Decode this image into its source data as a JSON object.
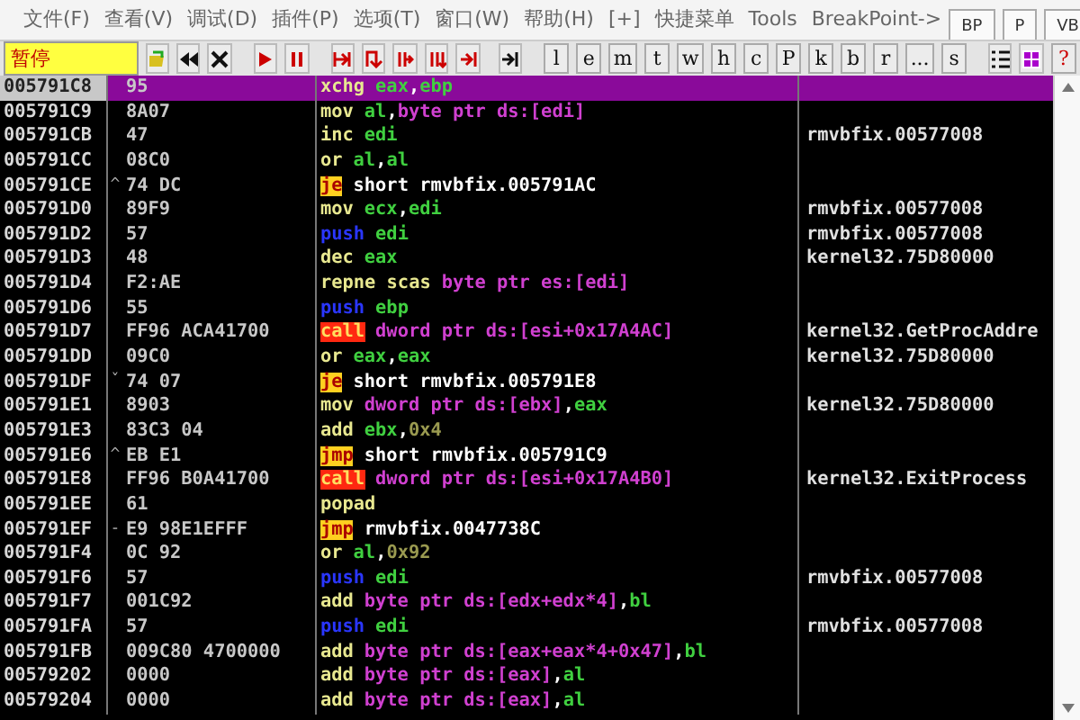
{
  "menu": [
    "文件(F)",
    "查看(V)",
    "调试(D)",
    "插件(P)",
    "选项(T)",
    "窗口(W)",
    "帮助(H)",
    "[+]",
    "快捷菜单",
    "Tools",
    "BreakPoint->"
  ],
  "window_tabs": [
    {
      "label": "BP",
      "selected": false
    },
    {
      "label": "P",
      "selected": false
    },
    {
      "label": "VB",
      "selected": false
    }
  ],
  "toolbar": {
    "status": "暂停",
    "letter_buttons": [
      "l",
      "e",
      "m",
      "t",
      "w",
      "h",
      "c",
      "P",
      "k",
      "b",
      "r",
      "...",
      "s"
    ],
    "help_button": "?"
  },
  "rows": [
    {
      "address": "005791C8",
      "hex": "95",
      "mnemonic": {
        "text": "xchg",
        "kind": "plain"
      },
      "operands": [
        {
          "text": "eax",
          "kind": "reg"
        },
        {
          "text": ",",
          "kind": "sep"
        },
        {
          "text": "ebp",
          "kind": "reg"
        }
      ],
      "selected": true
    },
    {
      "address": "005791C9",
      "hex": "8A07",
      "mnemonic": {
        "text": "mov",
        "kind": "plain"
      },
      "operands": [
        {
          "text": "al",
          "kind": "reg"
        },
        {
          "text": ",",
          "kind": "sep"
        },
        {
          "text": "byte ptr ds:[edi]",
          "kind": "mem"
        }
      ],
      "selected": false
    },
    {
      "address": "005791CB",
      "hex": "47",
      "mnemonic": {
        "text": "inc",
        "kind": "plain"
      },
      "operands": [
        {
          "text": "edi",
          "kind": "reg"
        }
      ],
      "comment": "rmvbfix.00577008",
      "selected": false
    },
    {
      "address": "005791CC",
      "hex": "08C0",
      "mnemonic": {
        "text": "or",
        "kind": "plain"
      },
      "operands": [
        {
          "text": "al",
          "kind": "reg"
        },
        {
          "text": ",",
          "kind": "sep"
        },
        {
          "text": "al",
          "kind": "reg"
        }
      ],
      "selected": false
    },
    {
      "address": "005791CE",
      "jump_mark": "^",
      "hex": "74 DC",
      "mnemonic": {
        "text": "je",
        "kind": "jcc"
      },
      "operands": [
        {
          "text": "short rmvbfix.005791AC",
          "kind": "label"
        }
      ],
      "selected": false
    },
    {
      "address": "005791D0",
      "hex": "89F9",
      "mnemonic": {
        "text": "mov",
        "kind": "plain"
      },
      "operands": [
        {
          "text": "ecx",
          "kind": "reg"
        },
        {
          "text": ",",
          "kind": "sep"
        },
        {
          "text": "edi",
          "kind": "reg"
        }
      ],
      "comment": "rmvbfix.00577008",
      "selected": false
    },
    {
      "address": "005791D2",
      "hex": "57",
      "mnemonic": {
        "text": "push",
        "kind": "push"
      },
      "operands": [
        {
          "text": "edi",
          "kind": "reg"
        }
      ],
      "comment": "rmvbfix.00577008",
      "selected": false
    },
    {
      "address": "005791D3",
      "hex": "48",
      "mnemonic": {
        "text": "dec",
        "kind": "plain"
      },
      "operands": [
        {
          "text": "eax",
          "kind": "reg"
        }
      ],
      "comment": "kernel32.75D80000",
      "selected": false
    },
    {
      "address": "005791D4",
      "hex": "F2:AE",
      "mnemonic": {
        "text": "repne scas",
        "kind": "plain"
      },
      "operands": [
        {
          "text": "byte ptr es:[edi]",
          "kind": "mem"
        }
      ],
      "selected": false
    },
    {
      "address": "005791D6",
      "hex": "55",
      "mnemonic": {
        "text": "push",
        "kind": "push"
      },
      "operands": [
        {
          "text": "ebp",
          "kind": "reg"
        }
      ],
      "selected": false
    },
    {
      "address": "005791D7",
      "hex": "FF96 ACA41700",
      "mnemonic": {
        "text": "call",
        "kind": "call"
      },
      "operands": [
        {
          "text": "dword ptr ds:[esi+0x17A4AC]",
          "kind": "mem"
        }
      ],
      "comment": "kernel32.GetProcAddre",
      "selected": false
    },
    {
      "address": "005791DD",
      "hex": "09C0",
      "mnemonic": {
        "text": "or",
        "kind": "plain"
      },
      "operands": [
        {
          "text": "eax",
          "kind": "reg"
        },
        {
          "text": ",",
          "kind": "sep"
        },
        {
          "text": "eax",
          "kind": "reg"
        }
      ],
      "comment": "kernel32.75D80000",
      "selected": false
    },
    {
      "address": "005791DF",
      "jump_mark": "ˇ",
      "hex": "74 07",
      "mnemonic": {
        "text": "je",
        "kind": "jcc"
      },
      "operands": [
        {
          "text": "short rmvbfix.005791E8",
          "kind": "label"
        }
      ],
      "selected": false
    },
    {
      "address": "005791E1",
      "hex": "8903",
      "mnemonic": {
        "text": "mov",
        "kind": "plain"
      },
      "operands": [
        {
          "text": "dword ptr ds:[ebx]",
          "kind": "mem"
        },
        {
          "text": ",",
          "kind": "sep"
        },
        {
          "text": "eax",
          "kind": "reg"
        }
      ],
      "comment": "kernel32.75D80000",
      "selected": false
    },
    {
      "address": "005791E3",
      "hex": "83C3 04",
      "mnemonic": {
        "text": "add",
        "kind": "plain"
      },
      "operands": [
        {
          "text": "ebx",
          "kind": "reg"
        },
        {
          "text": ",",
          "kind": "sep"
        },
        {
          "text": "0x4",
          "kind": "num"
        }
      ],
      "selected": false
    },
    {
      "address": "005791E6",
      "jump_mark": "^",
      "hex": "EB E1",
      "mnemonic": {
        "text": "jmp",
        "kind": "jmp"
      },
      "operands": [
        {
          "text": "short rmvbfix.005791C9",
          "kind": "label"
        }
      ],
      "selected": false
    },
    {
      "address": "005791E8",
      "hex": "FF96 B0A41700",
      "mnemonic": {
        "text": "call",
        "kind": "call"
      },
      "operands": [
        {
          "text": "dword ptr ds:[esi+0x17A4B0]",
          "kind": "mem"
        }
      ],
      "comment": "kernel32.ExitProcess",
      "selected": false
    },
    {
      "address": "005791EE",
      "hex": "61",
      "mnemonic": {
        "text": "popad",
        "kind": "plain"
      },
      "operands": [],
      "selected": false
    },
    {
      "address": "005791EF",
      "jump_mark": "-",
      "hex": "E9 98E1EFFF",
      "mnemonic": {
        "text": "jmp",
        "kind": "jmp"
      },
      "operands": [
        {
          "text": "rmvbfix.0047738C",
          "kind": "label"
        }
      ],
      "selected": false
    },
    {
      "address": "005791F4",
      "hex": "0C 92",
      "mnemonic": {
        "text": "or",
        "kind": "plain"
      },
      "operands": [
        {
          "text": "al",
          "kind": "reg"
        },
        {
          "text": ",",
          "kind": "sep"
        },
        {
          "text": "0x92",
          "kind": "num"
        }
      ],
      "selected": false
    },
    {
      "address": "005791F6",
      "hex": "57",
      "mnemonic": {
        "text": "push",
        "kind": "push"
      },
      "operands": [
        {
          "text": "edi",
          "kind": "reg"
        }
      ],
      "comment": "rmvbfix.00577008",
      "selected": false
    },
    {
      "address": "005791F7",
      "hex": "001C92",
      "mnemonic": {
        "text": "add",
        "kind": "plain"
      },
      "operands": [
        {
          "text": "byte ptr ds:[edx+edx*4]",
          "kind": "mem"
        },
        {
          "text": ",",
          "kind": "sep"
        },
        {
          "text": "bl",
          "kind": "reg"
        }
      ],
      "selected": false
    },
    {
      "address": "005791FA",
      "hex": "57",
      "mnemonic": {
        "text": "push",
        "kind": "push"
      },
      "operands": [
        {
          "text": "edi",
          "kind": "reg"
        }
      ],
      "comment": "rmvbfix.00577008",
      "selected": false
    },
    {
      "address": "005791FB",
      "hex": "009C80 4700000",
      "mnemonic": {
        "text": "add",
        "kind": "plain"
      },
      "operands": [
        {
          "text": "byte ptr ds:[eax+eax*4+0x47]",
          "kind": "mem"
        },
        {
          "text": ",",
          "kind": "sep"
        },
        {
          "text": "bl",
          "kind": "reg"
        }
      ],
      "selected": false
    },
    {
      "address": "00579202",
      "hex": "0000",
      "mnemonic": {
        "text": "add",
        "kind": "plain"
      },
      "operands": [
        {
          "text": "byte ptr ds:[eax]",
          "kind": "mem"
        },
        {
          "text": ",",
          "kind": "sep"
        },
        {
          "text": "al",
          "kind": "reg"
        }
      ],
      "selected": false
    },
    {
      "address": "00579204",
      "hex": "0000",
      "mnemonic": {
        "text": "add",
        "kind": "plain"
      },
      "operands": [
        {
          "text": "byte ptr ds:[eax]",
          "kind": "mem"
        },
        {
          "text": ",",
          "kind": "sep"
        },
        {
          "text": "al",
          "kind": "reg"
        }
      ],
      "selected": false
    }
  ]
}
